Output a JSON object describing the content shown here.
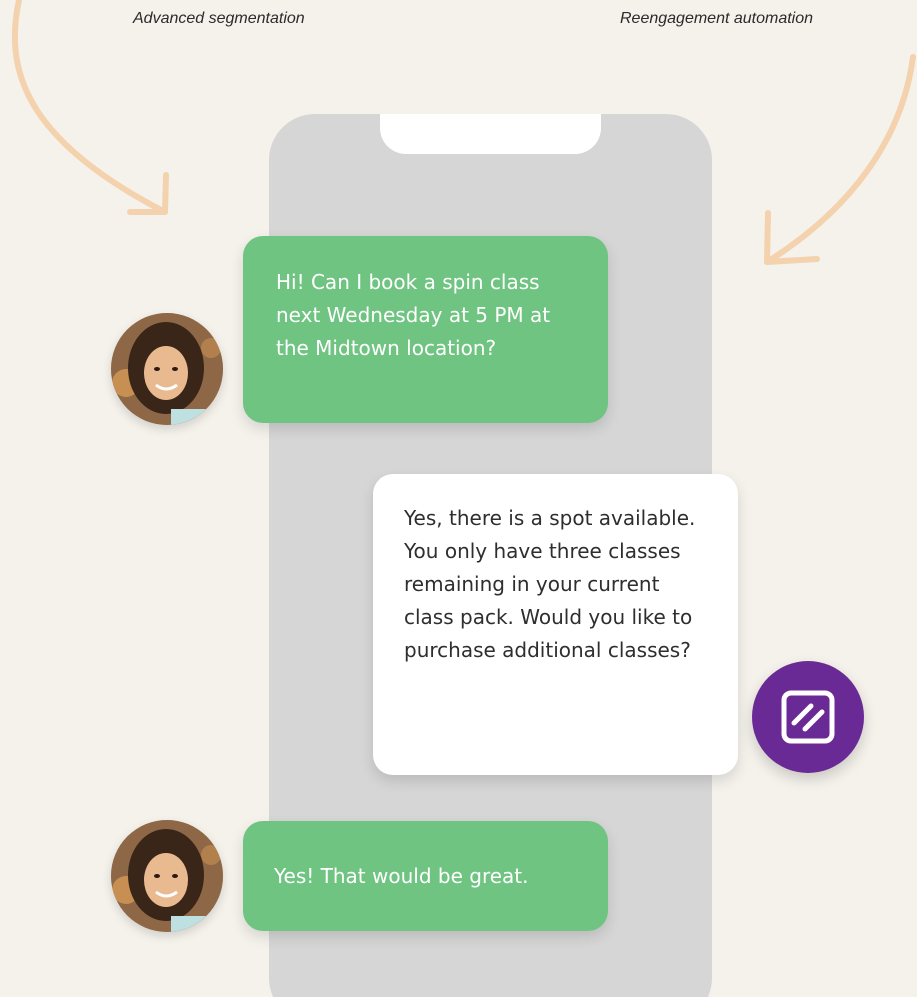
{
  "captions": {
    "left": "Advanced segmentation",
    "right": "Reengagement automation"
  },
  "messages": [
    {
      "sender": "user",
      "text": "Hi! Can I book a spin class next Wednesday at 5 PM at the Midtown location?"
    },
    {
      "sender": "bot",
      "text": "Yes, there is a spot available. You only have three classes remaining in your current class pack. Would you like to purchase additional classes?"
    },
    {
      "sender": "user",
      "text": "Yes! That would be great."
    }
  ],
  "icons": {
    "user_avatar": "user-avatar-photo",
    "bot_avatar": "brand-logo-icon",
    "arrows": "curved-arrow-icon"
  },
  "colors": {
    "background": "#f5f2ec",
    "phone": "#d6d6d6",
    "user_bubble": "#70c482",
    "bot_bubble": "#ffffff",
    "bot_avatar": "#6a2a96",
    "arrow": "#f3d2ad"
  }
}
